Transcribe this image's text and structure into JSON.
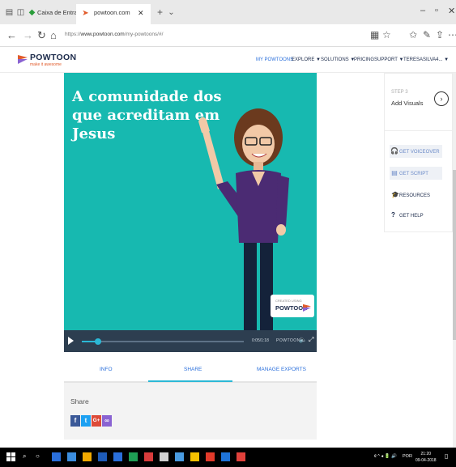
{
  "browser": {
    "tabs": [
      {
        "title": "Caixa de Entrada",
        "active": false
      },
      {
        "title": "powtoon.com",
        "active": true
      }
    ],
    "url_prefix": "https://",
    "url_host": "www.powtoon.com",
    "url_path": "/my-powtoons/#/"
  },
  "site": {
    "logo_text": "POWTOON",
    "logo_tagline": "make it awesome",
    "menu": [
      {
        "label": "MY POWTOONS",
        "active": true
      },
      {
        "label": "EXPLORE ▼",
        "active": false
      },
      {
        "label": "SOLUTIONS ▼",
        "active": false
      },
      {
        "label": "PRICING",
        "active": false
      },
      {
        "label": "SUPPORT ▼",
        "active": false
      },
      {
        "label": "TERESASILVA4... ▼",
        "active": false
      }
    ]
  },
  "video": {
    "headline": "A comunidade dos que acreditam em Jesus",
    "stamp_top": "CREATED USING",
    "stamp_brand": "POWTOON",
    "time": "0:05/1:18",
    "player_brand": "POWTOON",
    "progress": 0.1
  },
  "video_tabs": [
    {
      "label": "INFO",
      "active": false
    },
    {
      "label": "SHARE",
      "active": true
    },
    {
      "label": "MANAGE EXPORTS",
      "active": false
    }
  ],
  "share": {
    "label": "Share",
    "buttons": [
      {
        "name": "facebook",
        "glyph": "f",
        "color": "#3b5998"
      },
      {
        "name": "twitter",
        "glyph": "t",
        "color": "#1da1f2"
      },
      {
        "name": "google-plus",
        "glyph": "G+",
        "color": "#dd4b39"
      },
      {
        "name": "link",
        "glyph": "∞",
        "color": "#8a63d2"
      }
    ]
  },
  "sidebar": {
    "step_label": "STEP 3",
    "step_title": "Add Visuals",
    "buttons": [
      {
        "label": "GET VOICEOVER"
      },
      {
        "label": "GET SCRIPT"
      }
    ],
    "links": [
      {
        "label": "RESOURCES"
      },
      {
        "label": "GET HELP"
      }
    ]
  },
  "taskbar": {
    "clock_time": "21:20",
    "clock_date": "09-04-2018",
    "language": "POR"
  },
  "colors": {
    "video_bg": "#17b9b0",
    "accent_blue": "#2a6fdb",
    "brand_navy": "#1b2a4a"
  }
}
